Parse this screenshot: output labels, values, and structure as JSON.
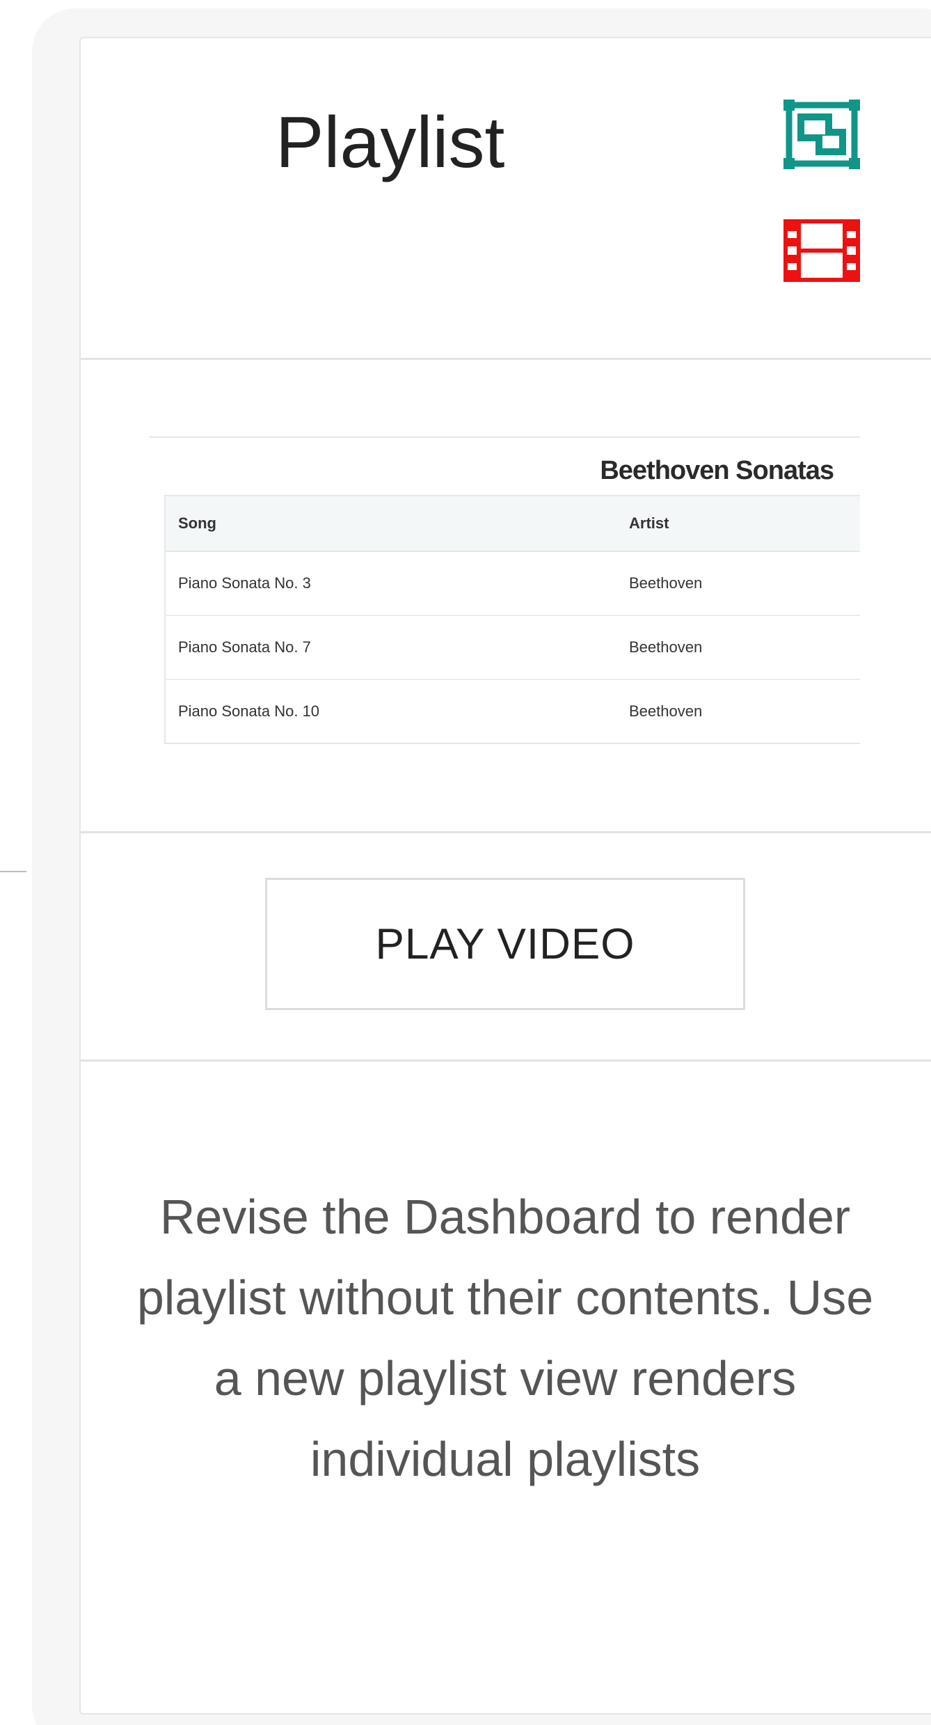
{
  "header": {
    "title": "Playlist",
    "layers_icon_color": "#0f9688",
    "film_icon_color": "#ee1111"
  },
  "playlist_table": {
    "caption": "Beethoven Sonatas",
    "columns": [
      "Song",
      "Artist"
    ],
    "rows": [
      {
        "song": "Piano Sonata No. 3",
        "artist": "Beethoven"
      },
      {
        "song": "Piano Sonata No. 7",
        "artist": "Beethoven"
      },
      {
        "song": "Piano Sonata No. 10",
        "artist": "Beethoven"
      }
    ]
  },
  "play_button": {
    "label": "PLAY VIDEO"
  },
  "note": {
    "text": "Revise the Dashboard to render playlist without their contents. Use a new playlist view renders individual playlists"
  }
}
